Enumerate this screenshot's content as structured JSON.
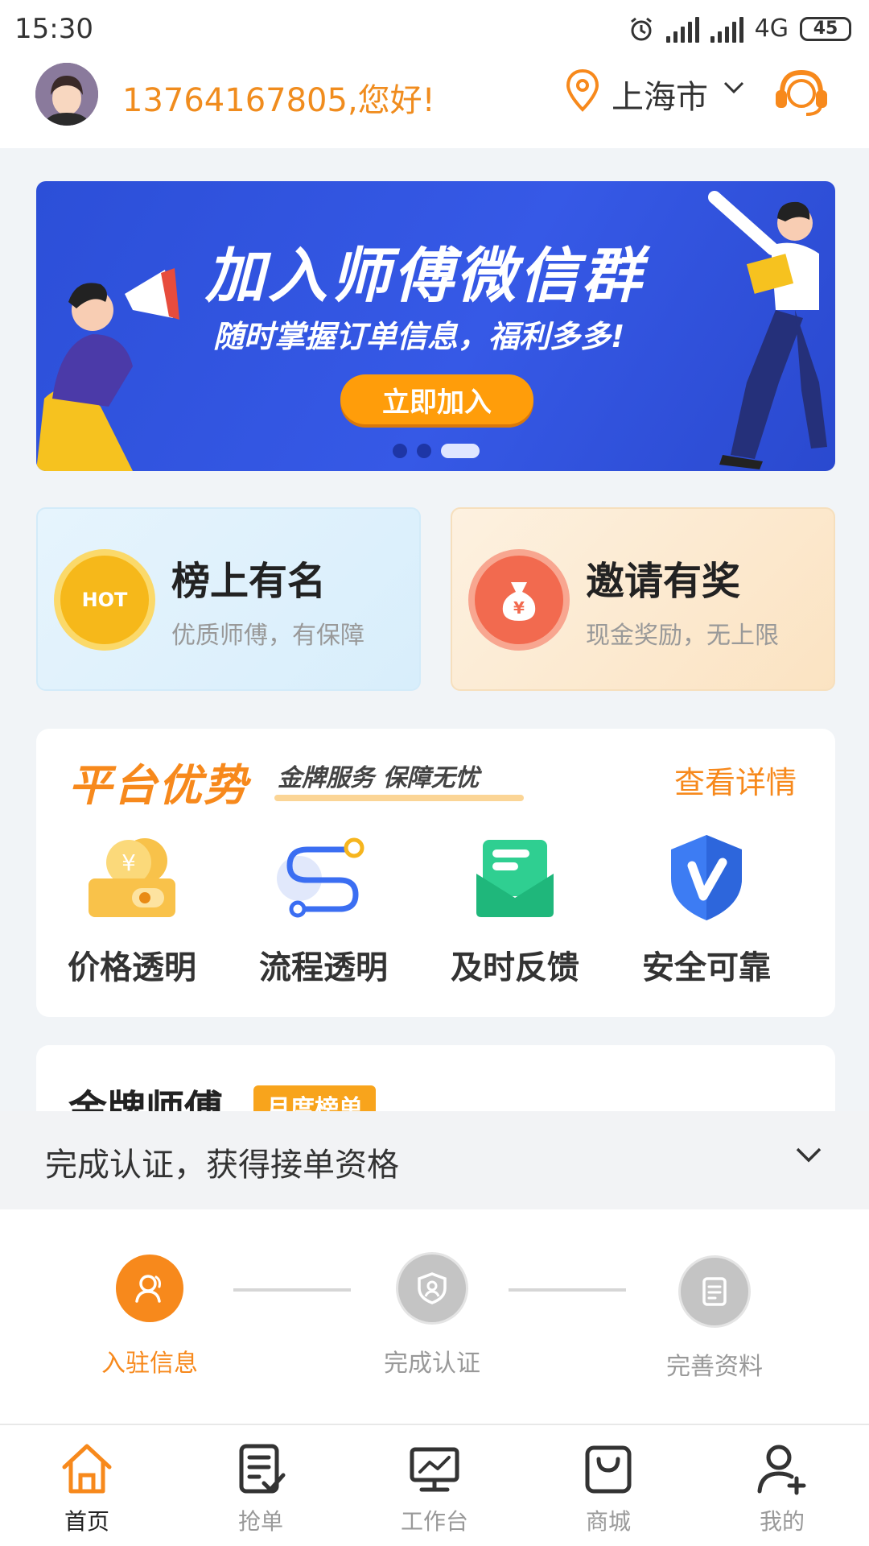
{
  "status_bar": {
    "time": "15:30",
    "network": "4G",
    "battery": "45"
  },
  "header": {
    "greeting": "13764167805,您好!",
    "city": "上海市"
  },
  "banner": {
    "title": "加入师傅微信群",
    "subtitle": "随时掌握订单信息，福利多多!",
    "button": "立即加入"
  },
  "promos": [
    {
      "title": "榜上有名",
      "subtitle": "优质师傅，有保障",
      "icon_text": "HOT"
    },
    {
      "title": "邀请有奖",
      "subtitle": "现金奖励，无上限",
      "icon_text": "¥"
    }
  ],
  "advantages": {
    "title": "平台优势",
    "subtitle": "金牌服务 保障无忧",
    "link": "查看详情",
    "items": [
      {
        "label": "价格透明",
        "icon": "coin-wallet-icon"
      },
      {
        "label": "流程透明",
        "icon": "process-flow-icon"
      },
      {
        "label": "及时反馈",
        "icon": "envelope-icon"
      },
      {
        "label": "安全可靠",
        "icon": "shield-v-icon"
      }
    ]
  },
  "ranking": {
    "title": "金牌师傅",
    "badge": "月度榜单"
  },
  "certification": {
    "prompt": "完成认证，获得接单资格",
    "steps": [
      {
        "label": "入驻信息",
        "state": "active"
      },
      {
        "label": "完成认证",
        "state": "inactive"
      },
      {
        "label": "完善资料",
        "state": "inactive"
      }
    ]
  },
  "bottom_nav": [
    {
      "label": "首页",
      "icon": "home-icon",
      "active": true
    },
    {
      "label": "抢单",
      "icon": "order-list-icon",
      "active": false
    },
    {
      "label": "工作台",
      "icon": "workbench-icon",
      "active": false
    },
    {
      "label": "商城",
      "icon": "shop-bag-icon",
      "active": false
    },
    {
      "label": "我的",
      "icon": "profile-add-icon",
      "active": false
    }
  ],
  "colors": {
    "accent": "#f7891c",
    "banner_blue": "#3659e6"
  }
}
